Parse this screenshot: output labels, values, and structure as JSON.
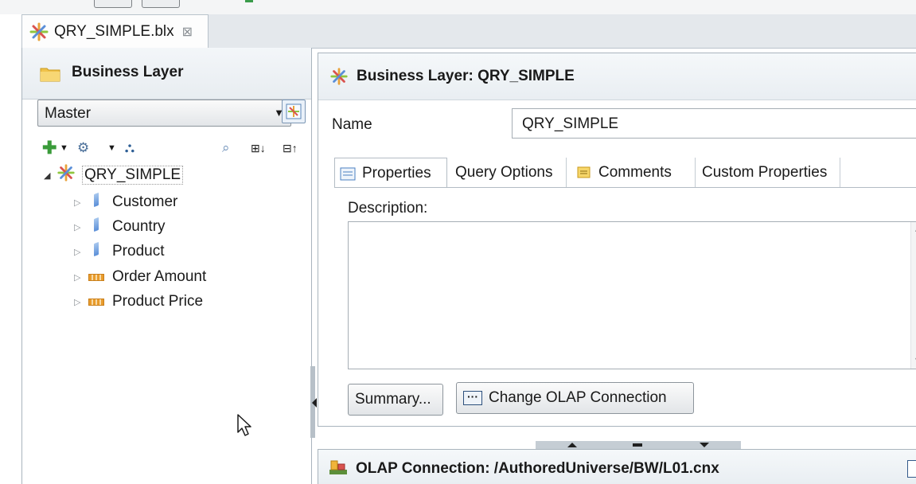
{
  "editor_tab": {
    "filename": "QRY_SIMPLE.blx",
    "close_glyph": "⊠"
  },
  "left_panel": {
    "title": "Business Layer",
    "view_select": {
      "value": "Master"
    },
    "tree": {
      "root": "QRY_SIMPLE",
      "items": [
        {
          "label": "Customer",
          "type": "dimension"
        },
        {
          "label": "Country",
          "type": "dimension"
        },
        {
          "label": "Product",
          "type": "dimension"
        },
        {
          "label": "Order Amount",
          "type": "measure"
        },
        {
          "label": "Product Price",
          "type": "measure"
        }
      ]
    }
  },
  "right_panel": {
    "title": "Business Layer: QRY_SIMPLE",
    "name_label": "Name",
    "name_value": "QRY_SIMPLE",
    "tabs": [
      "Properties",
      "Query Options",
      "Comments",
      "Custom Properties"
    ],
    "description_label": "Description:",
    "summary_button": "Summary...",
    "change_olap_button": "Change OLAP Connection"
  },
  "bottom_panel": {
    "title": "OLAP Connection: /AuthoredUniverse/BW/L01.cnx"
  },
  "colors": {
    "accent": "#4a7fc1",
    "panel_header": "#e9eef2",
    "tab_strip": "#e4e8ec"
  }
}
